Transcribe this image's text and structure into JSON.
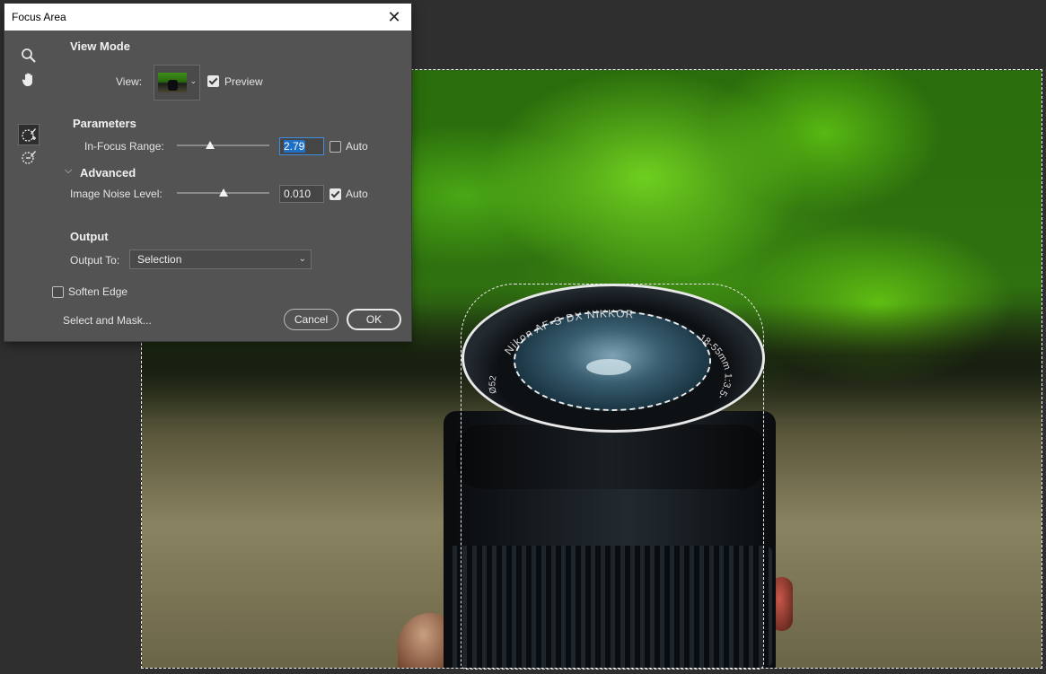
{
  "dialog": {
    "title": "Focus Area",
    "close_label": "✕",
    "view_mode": {
      "heading": "View Mode",
      "view_label": "View:",
      "preview_label": "Preview",
      "preview_checked": true
    },
    "parameters": {
      "heading": "Parameters",
      "in_focus_range_label": "In-Focus Range:",
      "in_focus_range_value": "2.79",
      "in_focus_range_slider": 0.36,
      "in_focus_auto_label": "Auto",
      "in_focus_auto_checked": false,
      "advanced_label": "Advanced",
      "noise_label": "Image Noise Level:",
      "noise_value": "0.010",
      "noise_slider": 0.5,
      "noise_auto_label": "Auto",
      "noise_auto_checked": true
    },
    "output": {
      "heading": "Output",
      "output_to_label": "Output To:",
      "output_to_value": "Selection"
    },
    "soften_edge_label": "Soften Edge",
    "soften_edge_checked": false,
    "select_and_mask_label": "Select and Mask...",
    "cancel_label": "Cancel",
    "ok_label": "OK",
    "tools": [
      "zoom-tool",
      "hand-tool",
      "focus-area-add-tool",
      "focus-area-subtract-tool"
    ]
  },
  "photo": {
    "lens_text_top": "Nikon AF-S DX NIKKOR",
    "lens_text_right": "18-55mm 1:3.5-5.6",
    "lens_text_left": "Ø52"
  }
}
